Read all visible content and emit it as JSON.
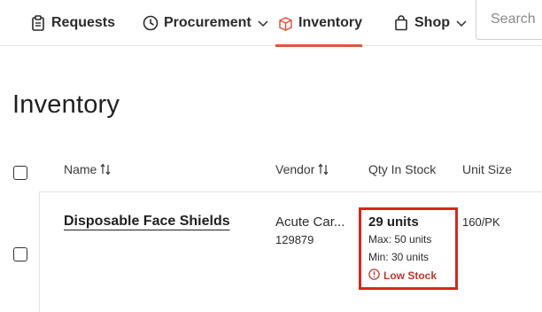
{
  "nav": {
    "requests": "Requests",
    "procurement": "Procurement",
    "inventory": "Inventory",
    "shop": "Shop",
    "search_placeholder": "Search"
  },
  "page": {
    "title": "Inventory"
  },
  "table": {
    "columns": {
      "name": "Name",
      "vendor": "Vendor",
      "qty": "Qty In Stock",
      "unit_size": "Unit Size"
    },
    "rows": [
      {
        "name": "Disposable Face Shields",
        "vendor": "Acute Car...",
        "vendor_id": "129879",
        "qty": "29 units",
        "max": "Max: 50 units",
        "min": "Min: 30 units",
        "status": "Low Stock",
        "unit_size": "160/PK"
      }
    ]
  },
  "colors": {
    "accent": "#e2543c",
    "alert": "#c0392b",
    "highlight_box": "#d9261c"
  }
}
